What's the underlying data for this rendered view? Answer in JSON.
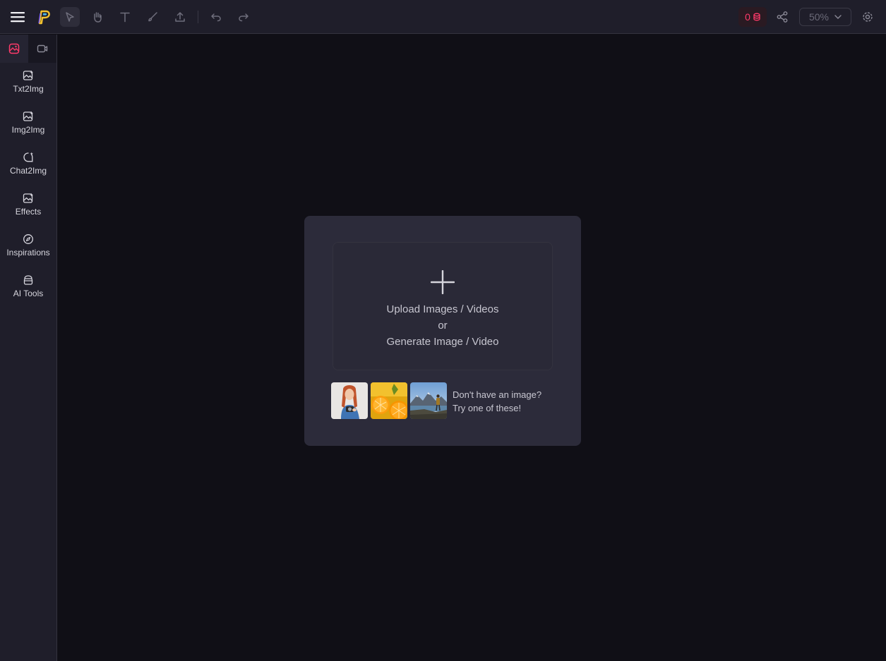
{
  "toolbar": {
    "menu_icon": "hamburger-icon",
    "logo_icon": "p-logo-icon",
    "tools": [
      {
        "name": "select-tool",
        "icon": "cursor-icon",
        "active": true
      },
      {
        "name": "hand-tool",
        "icon": "hand-icon",
        "active": false
      },
      {
        "name": "text-tool",
        "icon": "text-icon",
        "active": false
      },
      {
        "name": "brush-tool",
        "icon": "brush-icon",
        "active": false
      },
      {
        "name": "upload-tool",
        "icon": "upload-icon",
        "active": false
      }
    ],
    "undo_icon": "undo-icon",
    "redo_icon": "redo-icon",
    "credits": "0",
    "credits_icon": "coin-icon",
    "share_icon": "share-icon",
    "zoom": "50%",
    "settings_icon": "settings-icon"
  },
  "sidebar": {
    "mode_tabs": [
      {
        "name": "image-mode",
        "icon": "image-icon",
        "active": true
      },
      {
        "name": "video-mode",
        "icon": "video-icon",
        "active": false
      }
    ],
    "items": [
      {
        "label": "Txt2Img",
        "icon": "image-sparkle-icon"
      },
      {
        "label": "Img2Img",
        "icon": "image-sparkle-icon"
      },
      {
        "label": "Chat2Img",
        "icon": "chat-icon"
      },
      {
        "label": "Effects",
        "icon": "image-sparkle-icon"
      },
      {
        "label": "Inspirations",
        "icon": "compass-icon"
      },
      {
        "label": "AI Tools",
        "icon": "toolbox-icon"
      }
    ]
  },
  "upload_card": {
    "line1": "Upload Images / Videos",
    "line2": "or",
    "line3": "Generate Image / Video",
    "samples": [
      "woman-with-camera",
      "orange-slices",
      "mountain-lake-hiker"
    ],
    "sample_text_1": "Don't have an image?",
    "sample_text_2": "Try one of these!"
  },
  "colors": {
    "accent": "#ff3a6a",
    "background": "#100f16",
    "panel": "#1f1e2a",
    "card": "#2c2b3a"
  }
}
